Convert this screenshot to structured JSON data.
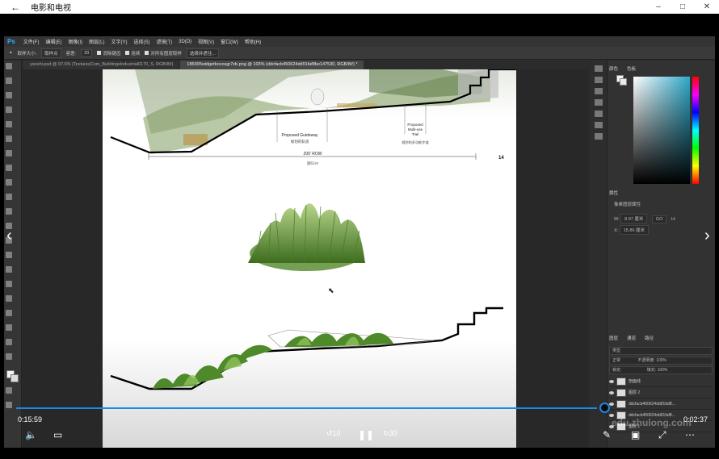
{
  "window": {
    "title": "电影和电视",
    "controls": [
      "–",
      "□",
      "✕"
    ]
  },
  "photoshop": {
    "logo": "Ps",
    "menu": [
      "文件(F)",
      "编辑(E)",
      "图像(I)",
      "图层(L)",
      "文字(Y)",
      "选择(S)",
      "滤镜(T)",
      "3D(D)",
      "视图(V)",
      "窗口(W)",
      "帮助(H)"
    ],
    "options": {
      "sample_size_label": "取样大小:",
      "sample_size_value": "取样点",
      "tolerance_label": "容差:",
      "tolerance_value": "20",
      "anti_alias": "消除锯齿",
      "contiguous": "连续",
      "sample_all": "对所有图层取样",
      "select_subject": "选择并遮住..."
    },
    "tabs": [
      "yanshi.psd @ 97.6% (TexturesCom_BuildingsIndustrial0170_S, RGB/8#)",
      "185005widgetbocosgr7zb.png @ 103% (ddcfacb450624dd91faf8be147530, RGB/8#) *"
    ],
    "document": {
      "label_guideway_en": "Proposed Guideway",
      "label_guideway_cn": "规划的轨道",
      "label_trail_en_1": "Proposed",
      "label_trail_en_2": "Multi-use",
      "label_trail_en_3": "Trail",
      "label_trail_cn": "规划的多功能步道",
      "row_en": "200' ROW",
      "row_cn": "宽61m",
      "page_number": "14"
    },
    "panels": {
      "color_tab": "颜色",
      "swatch_tab": "色板",
      "properties_tab": "属性",
      "properties_title": "像素图层属性",
      "w_label": "W:",
      "w_value": "8.97 厘米",
      "h_label": "H:",
      "go_label": "GO",
      "x_label": "X:",
      "x_value": "15.86 厘米",
      "layers_tab": "图层",
      "channels_tab": "通道",
      "paths_tab": "路径",
      "kind_filter": "类型",
      "blend_mode": "正常",
      "opacity_label": "不透明度:",
      "opacity_value": "100%",
      "fill_label": "填充:",
      "fill_value": "100%",
      "lock_label": "锁定:",
      "layers": [
        {
          "name": "剖面线"
        },
        {
          "name": "图层 2"
        },
        {
          "name": "ddcfacb450624dd91faf8..."
        },
        {
          "name": "ddcfacb450624dd91faf8..."
        },
        {
          "name": "图层 1"
        }
      ]
    }
  },
  "player": {
    "current_time": "0:15:59",
    "total_time": "0:02:37",
    "progress": 0.985,
    "rewind_label": "10",
    "forward_label": "30",
    "watermark": "edu.zhulong.com",
    "colors": {
      "accent": "#1e88e5"
    }
  }
}
